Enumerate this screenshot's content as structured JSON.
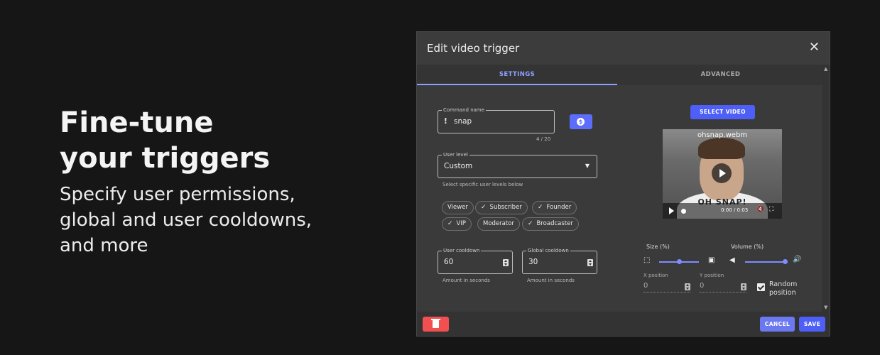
{
  "hero": {
    "title_line1": "Fine-tune",
    "title_line2": "your triggers",
    "subtitle_line1": "Specify user permissions,",
    "subtitle_line2": "global and user cooldowns,",
    "subtitle_line3": "and more"
  },
  "dialog": {
    "title": "Edit video trigger",
    "close_icon": "close-icon",
    "tabs": [
      {
        "label": "SETTINGS",
        "active": true
      },
      {
        "label": "ADVANCED",
        "active": false
      }
    ],
    "command": {
      "label": "Command name",
      "prefix": "!",
      "value": "snap",
      "counter": "4 / 20",
      "price_icon": "dollar-icon"
    },
    "user_level": {
      "label": "User level",
      "value": "Custom",
      "hint": "Select specific user levels below"
    },
    "chips": [
      {
        "label": "Viewer",
        "checked": false
      },
      {
        "label": "Subscriber",
        "checked": true
      },
      {
        "label": "Founder",
        "checked": true
      },
      {
        "label": "VIP",
        "checked": true
      },
      {
        "label": "Moderator",
        "checked": false
      },
      {
        "label": "Broadcaster",
        "checked": true
      }
    ],
    "user_cooldown": {
      "label": "User cooldown",
      "value": "60",
      "hint": "Amount in seconds"
    },
    "global_cooldown": {
      "label": "Global cooldown",
      "value": "30",
      "hint": "Amount in seconds"
    },
    "select_video_label": "SELECT VIDEO",
    "video": {
      "filename": "ohsnap.webm",
      "caption": "OH SNAP!",
      "time": "0:00 / 0:03"
    },
    "size": {
      "label": "Size (%)",
      "value": 0.5
    },
    "volume": {
      "label": "Volume (%)",
      "value": 1.0
    },
    "x_position": {
      "label": "X position",
      "value": "0"
    },
    "y_position": {
      "label": "Y position",
      "value": "0"
    },
    "random_position": {
      "label": "Random position",
      "checked": true
    },
    "cancel_label": "CANCEL",
    "save_label": "SAVE"
  },
  "colors": {
    "accent": "#5d6dfb",
    "danger": "#f25050",
    "background": "#161616",
    "dialog": "#3c3c3c"
  }
}
